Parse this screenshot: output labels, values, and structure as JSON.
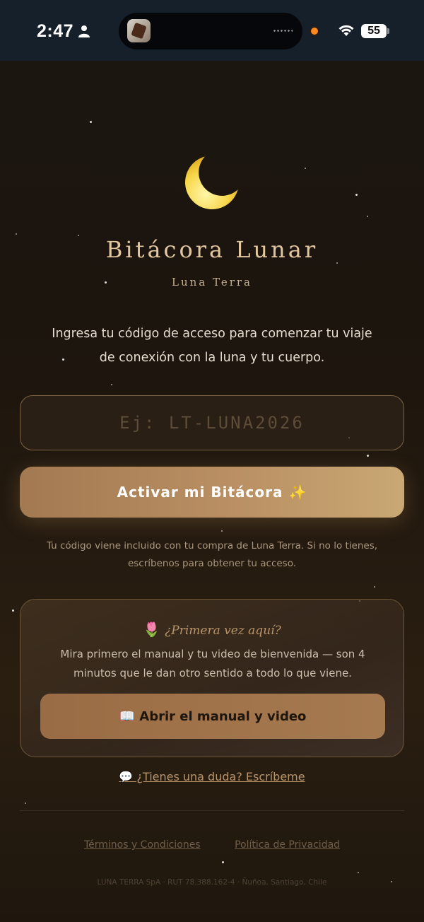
{
  "status_bar": {
    "time": "2:47",
    "battery": "55",
    "icons": [
      "person-icon",
      "wifi-icon",
      "battery-icon",
      "camera-indicator-dot"
    ]
  },
  "branding": {
    "title": "Bitácora Lunar",
    "subtitle": "Luna Terra",
    "logo_icon": "crescent-moon-icon"
  },
  "intro_text": "Ingresa tu código de acceso para comenzar tu viaje de conexión con la luna y tu cuerpo.",
  "code_field": {
    "placeholder": "Ej: LT-LUNA2026",
    "value": ""
  },
  "activate_button": {
    "label": "Activar mi Bitácora ✨"
  },
  "helper_text": "Tu código viene incluido con tu compra de Luna Terra. Si no lo tienes, escríbenos para obtener tu acceso.",
  "first_time_card": {
    "emoji": "🌷",
    "heading": "¿Primera vez aquí?",
    "body": "Mira primero el manual y tu video de bienvenida — son 4 minutos que le dan otro sentido a todo lo que viene.",
    "button_label": "📖 Abrir el manual y video"
  },
  "contact_link": "💬 ¿Tienes una duda? Escríbeme",
  "footer": {
    "terms": "Términos y Condiciones",
    "privacy": "Política de Privacidad",
    "legal": "LUNA TERRA SpA · RUT 78.388.162-4 · Ñuñoa, Santiago, Chile"
  },
  "colors": {
    "accent_gold": "#c9a874",
    "button_bronze": "#a37952",
    "background": "#1c150e"
  }
}
